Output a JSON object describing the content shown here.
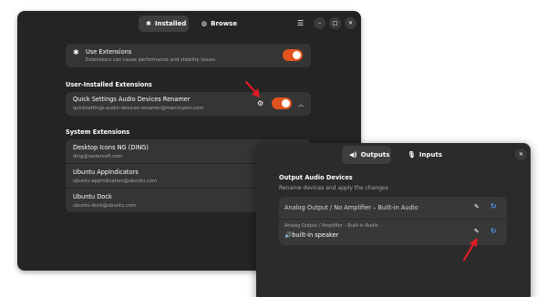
{
  "main": {
    "tabs": [
      {
        "label": "Installed",
        "icon": "puzzle-icon"
      },
      {
        "label": "Browse",
        "icon": "globe-icon"
      }
    ],
    "use_extensions": {
      "title": "Use Extensions",
      "subtitle": "Extensions can cause performance and stability issues",
      "enabled": true
    },
    "user_section": "User-Installed Extensions",
    "user_extensions": [
      {
        "name": "Quick Settings Audio Devices Renamer",
        "id": "quicksettings-audio-devices-renamer@marcinjahn.com",
        "enabled": true
      }
    ],
    "system_section": "System Extensions",
    "system_extensions": [
      {
        "name": "Desktop Icons NG (DING)",
        "id": "ding@rastersoft.com"
      },
      {
        "name": "Ubuntu AppIndicators",
        "id": "ubuntu-appindicators@ubuntu.com"
      },
      {
        "name": "Ubuntu Dock",
        "id": "ubuntu-dock@ubuntu.com"
      }
    ],
    "accent_color": "#e0531c"
  },
  "prefs": {
    "tabs": [
      {
        "label": "Outputs",
        "icon": "speaker-icon"
      },
      {
        "label": "Inputs",
        "icon": "microphone-icon"
      }
    ],
    "heading": "Output Audio Devices",
    "subtitle": "Rename devices and apply the changes",
    "devices": [
      {
        "name": "Analog Output / No Amplifier – Built-in Audio"
      },
      {
        "original": "Analog Output / Amplifier – Built-in Audio",
        "name": "🔊built-in speaker"
      }
    ],
    "refresh_color": "#4b9be9"
  }
}
